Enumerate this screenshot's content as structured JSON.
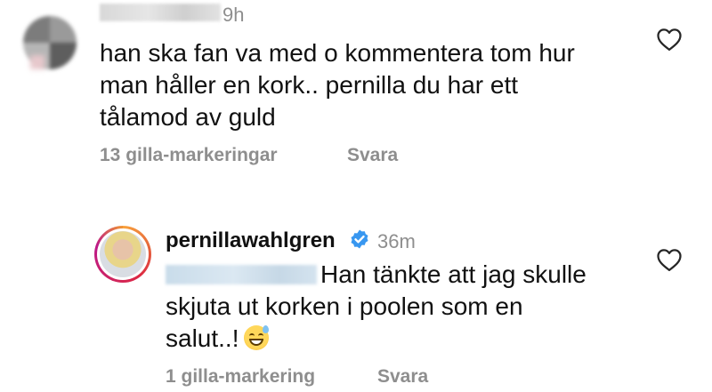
{
  "comments": [
    {
      "time": "9h",
      "text_lines": [
        "han ska fan va med o kommentera tom hur",
        "man håller en kork.. pernilla du har ett",
        "tålamod av guld"
      ],
      "likes": "13 gilla-markeringar",
      "reply": "Svara"
    },
    {
      "username": "pernillawahlgren",
      "verified": true,
      "time": "36m",
      "text_lines": [
        "Han tänkte att jag skulle",
        "skjuta ut korken i poolen som en",
        "salut..!"
      ],
      "emoji": "sweat-smile-emoji",
      "likes": "1 gilla-markering",
      "reply": "Svara"
    }
  ],
  "colors": {
    "text": "#111111",
    "secondary": "#8e8e8e",
    "verified": "#3897f0"
  }
}
